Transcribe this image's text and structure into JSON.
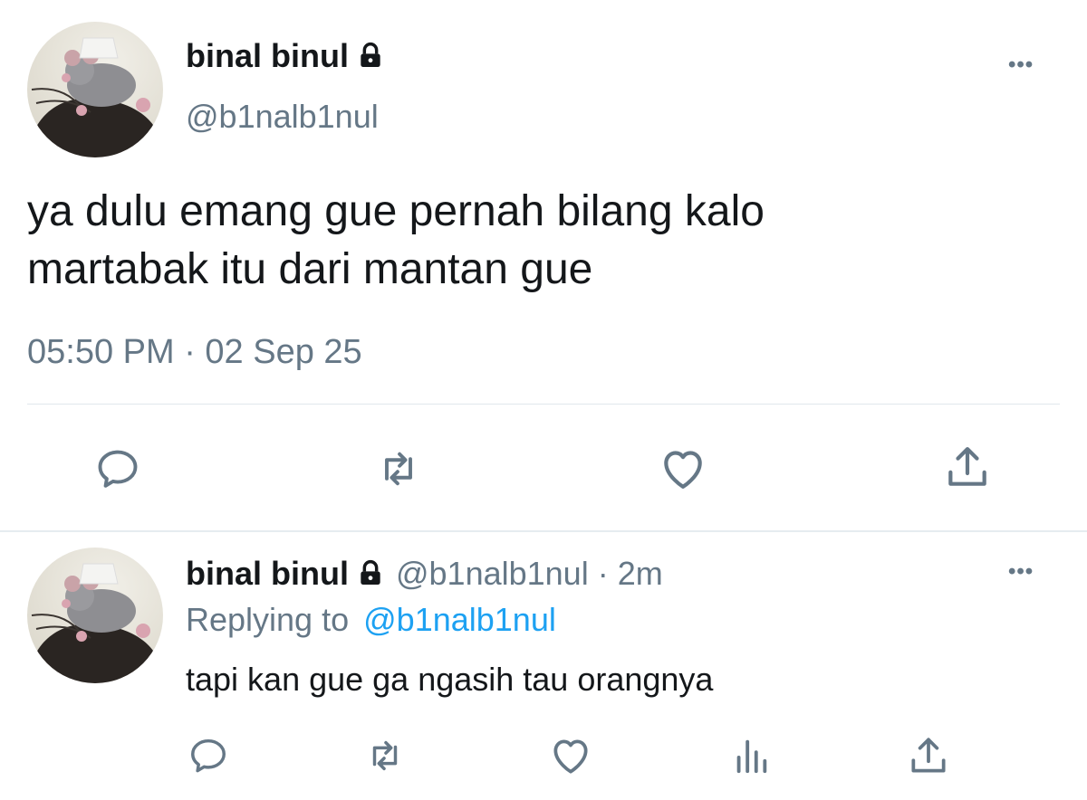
{
  "main_tweet": {
    "display_name": "binal binul",
    "handle": "@b1nalb1nul",
    "text_line1": "ya dulu emang gue pernah bilang kalo",
    "text_line2": "martabak itu dari mantan gue",
    "timestamp": "05:50 PM · 02 Sep 25",
    "more_label": "•••",
    "actions": [
      "reply-icon",
      "retweet-icon",
      "like-icon",
      "share-icon"
    ],
    "locked": true
  },
  "reply_tweet": {
    "display_name": "binal binul",
    "handle": "@b1nalb1nul",
    "separator": "·",
    "age": "2m",
    "replying_prefix": "Replying to",
    "replying_handle": "@b1nalb1nul",
    "text": "tapi kan gue ga ngasih tau orangnya",
    "more_label": "•••",
    "actions": [
      "reply-icon",
      "retweet-icon",
      "like-icon",
      "analytics-icon",
      "share-icon"
    ],
    "locked": true
  },
  "colors": {
    "text": "#14171a",
    "secondary": "#657786",
    "link": "#1da1f2",
    "divider": "#e1e8ed"
  }
}
